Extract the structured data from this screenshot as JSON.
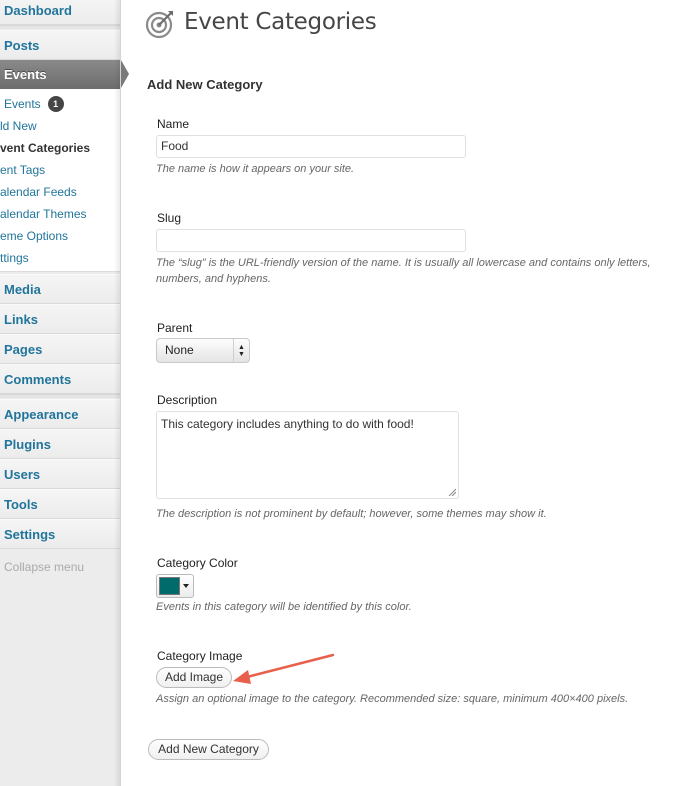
{
  "sidebar": {
    "top_items": {
      "dashboard": "Dashboard",
      "posts": "Posts",
      "events": "Events",
      "media": "Media",
      "links": "Links",
      "pages": "Pages",
      "comments": "Comments",
      "appearance": "Appearance",
      "plugins": "Plugins",
      "users": "Users",
      "tools": "Tools",
      "settings": "Settings"
    },
    "submenu": [
      {
        "label": "Events",
        "badge": "1"
      },
      {
        "label": "ld New"
      },
      {
        "label": "vent Categories"
      },
      {
        "label": "ent Tags"
      },
      {
        "label": "alendar Feeds"
      },
      {
        "label": "alendar Themes"
      },
      {
        "label": "eme Options"
      },
      {
        "label": "ttings"
      }
    ],
    "collapse_label": "Collapse menu"
  },
  "page": {
    "title": "Event Categories",
    "icon": "target-icon"
  },
  "form": {
    "heading": "Add New Category",
    "name": {
      "label": "Name",
      "value": "Food",
      "help": "The name is how it appears on your site."
    },
    "slug": {
      "label": "Slug",
      "value": "",
      "help": "The “slug” is the URL-friendly version of the name. It is usually all lowercase and contains only letters, numbers, and hyphens."
    },
    "parent": {
      "label": "Parent",
      "selected": "None"
    },
    "description": {
      "label": "Description",
      "value": "This category includes anything to do with food!",
      "help": "The description is not prominent by default; however, some themes may show it."
    },
    "color": {
      "label": "Category Color",
      "value": "#006b6b",
      "help": "Events in this category will be identified by this color."
    },
    "image": {
      "label": "Category Image",
      "button": "Add Image",
      "help": "Assign an optional image to the category. Recommended size: square, minimum 400×400 pixels."
    },
    "submit": "Add New Category"
  },
  "colors": {
    "link": "#21759b",
    "active_menu": "#6d6d6d",
    "annotation_arrow": "#e8604c"
  }
}
